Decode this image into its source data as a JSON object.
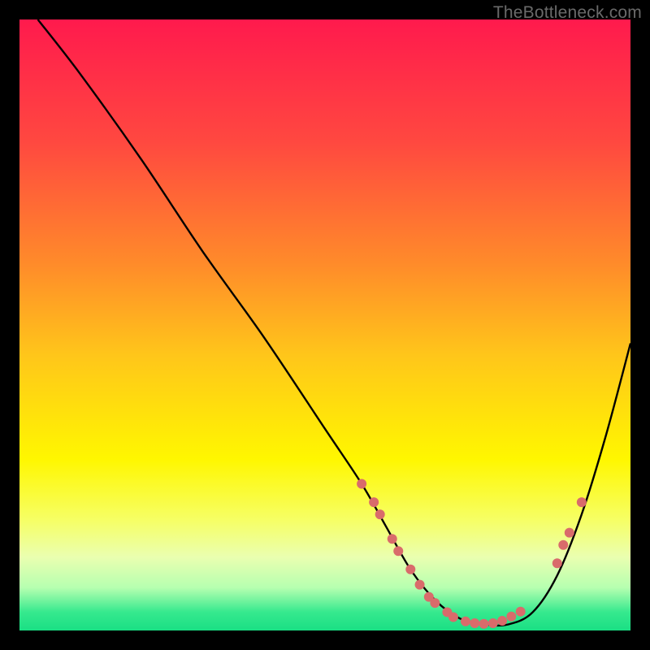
{
  "watermark": "TheBottleneck.com",
  "chart_data": {
    "type": "line",
    "title": "",
    "xlabel": "",
    "ylabel": "",
    "xlim": [
      0,
      100
    ],
    "ylim": [
      0,
      100
    ],
    "background_gradient": {
      "orientation": "vertical",
      "stops": [
        {
          "pos": 0.0,
          "color": "#ff1a4d"
        },
        {
          "pos": 0.2,
          "color": "#ff4840"
        },
        {
          "pos": 0.4,
          "color": "#ff8b2a"
        },
        {
          "pos": 0.55,
          "color": "#ffc61a"
        },
        {
          "pos": 0.72,
          "color": "#fff700"
        },
        {
          "pos": 0.82,
          "color": "#f6ff66"
        },
        {
          "pos": 0.88,
          "color": "#eaffb0"
        },
        {
          "pos": 0.93,
          "color": "#b6ffb0"
        },
        {
          "pos": 0.97,
          "color": "#36e98e"
        },
        {
          "pos": 1.0,
          "color": "#1adf84"
        }
      ]
    },
    "series": [
      {
        "name": "bottleneck-curve",
        "color": "#000000",
        "x": [
          3,
          10,
          20,
          30,
          40,
          50,
          56,
          60,
          64,
          68,
          72,
          76,
          80,
          84,
          88,
          92,
          96,
          100
        ],
        "y": [
          100,
          91,
          77,
          62,
          48,
          33,
          24,
          17,
          10,
          5,
          2,
          1,
          1,
          3,
          9,
          19,
          32,
          47
        ]
      }
    ],
    "scatter_points": {
      "name": "highlight-dots",
      "color": "#d96b6b",
      "radius": 6,
      "points": [
        {
          "x": 56,
          "y": 24
        },
        {
          "x": 58,
          "y": 21
        },
        {
          "x": 59,
          "y": 19
        },
        {
          "x": 61,
          "y": 15
        },
        {
          "x": 62,
          "y": 13
        },
        {
          "x": 64,
          "y": 10
        },
        {
          "x": 65.5,
          "y": 7.5
        },
        {
          "x": 67,
          "y": 5.5
        },
        {
          "x": 68,
          "y": 4.5
        },
        {
          "x": 70,
          "y": 3
        },
        {
          "x": 71,
          "y": 2.2
        },
        {
          "x": 73,
          "y": 1.5
        },
        {
          "x": 74.5,
          "y": 1.2
        },
        {
          "x": 76,
          "y": 1.1
        },
        {
          "x": 77.5,
          "y": 1.2
        },
        {
          "x": 79,
          "y": 1.6
        },
        {
          "x": 80.5,
          "y": 2.3
        },
        {
          "x": 82,
          "y": 3.1
        },
        {
          "x": 88,
          "y": 11
        },
        {
          "x": 89,
          "y": 14
        },
        {
          "x": 90,
          "y": 16
        },
        {
          "x": 92,
          "y": 21
        }
      ]
    }
  }
}
